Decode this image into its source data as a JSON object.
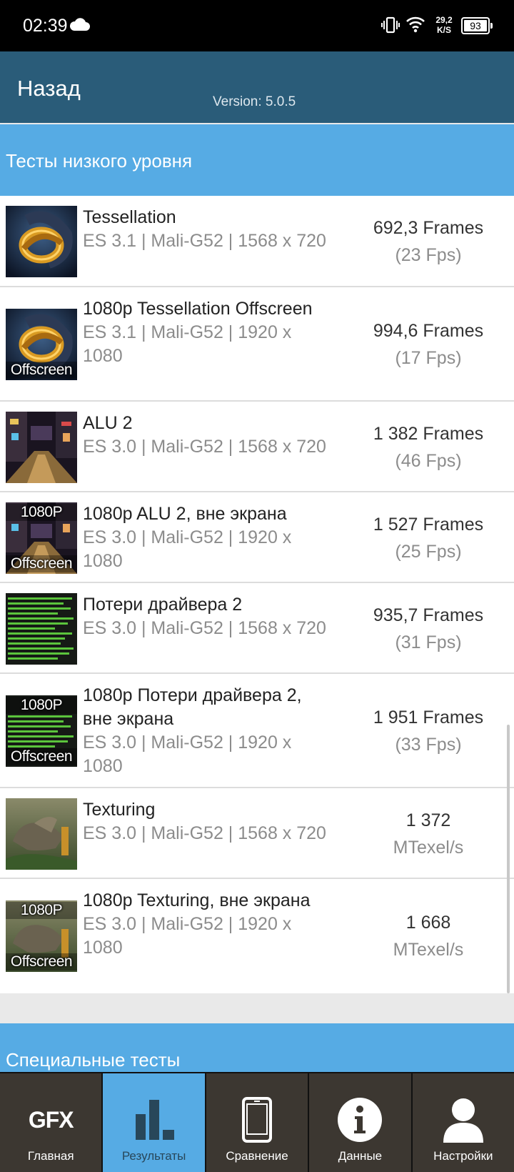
{
  "status_bar": {
    "time": "02:39",
    "net_speed_value": "29,2",
    "net_speed_unit": "K/S",
    "battery": "93"
  },
  "header": {
    "back_label": "Назад",
    "version": "Version: 5.0.5"
  },
  "section": {
    "title": "Тесты низкого уровня"
  },
  "tests": [
    {
      "name": "Tessellation",
      "spec": "ES 3.1 | Mali-G52 | 1568 x 720",
      "result": "692,3 Frames",
      "sub": "(23 Fps)",
      "thumb": "tessellation"
    },
    {
      "name": "1080p Tessellation Offscreen",
      "spec": "ES 3.1 | Mali-G52 | 1920 x 1080",
      "result": "994,6 Frames",
      "sub": "(17 Fps)",
      "thumb": "tessellation",
      "thumb_bottom": "Offscreen"
    },
    {
      "name": "ALU 2",
      "spec": "ES 3.0 | Mali-G52 | 1568 x 720",
      "result": "1 382 Frames",
      "sub": "(46 Fps)",
      "thumb": "alu"
    },
    {
      "name": "1080p ALU 2, вне экрана",
      "spec": "ES 3.0 | Mali-G52 | 1920 x 1080",
      "result": "1 527 Frames",
      "sub": "(25 Fps)",
      "thumb": "alu",
      "thumb_top": "1080P",
      "thumb_bottom": "Offscreen"
    },
    {
      "name": "Потери драйвера 2",
      "spec": "ES 3.0 | Mali-G52 | 1568 x 720",
      "result": "935,7 Frames",
      "sub": "(31 Fps)",
      "thumb": "driver"
    },
    {
      "name": "1080p Потери драйвера 2, вне экрана",
      "spec": "ES 3.0 | Mali-G52 | 1920 x 1080",
      "result": "1 951 Frames",
      "sub": "(33 Fps)",
      "thumb": "driver",
      "thumb_top": "1080P",
      "thumb_bottom": "Offscreen"
    },
    {
      "name": "Texturing",
      "spec": "ES 3.0 | Mali-G52 | 1568 x 720",
      "result": "1 372",
      "sub": "MTexel/s",
      "thumb": "texturing"
    },
    {
      "name": "1080p Texturing, вне экрана",
      "spec": "ES 3.0 | Mali-G52 | 1920 x 1080",
      "result": "1 668",
      "sub": "MTexel/s",
      "thumb": "texturing",
      "thumb_top": "1080P",
      "thumb_bottom": "Offscreen"
    }
  ],
  "special_section": {
    "title": "Специальные тесты"
  },
  "nav": {
    "items": [
      {
        "label": "Главная",
        "icon": "gfx-logo-icon",
        "icon_text": "GFX"
      },
      {
        "label": "Результаты",
        "icon": "bar-chart-icon",
        "active": true
      },
      {
        "label": "Сравнение",
        "icon": "phone-icon"
      },
      {
        "label": "Данные",
        "icon": "info-icon"
      },
      {
        "label": "Настройки",
        "icon": "user-icon"
      }
    ]
  },
  "colors": {
    "header": "#2a5c79",
    "section": "#56abe4",
    "nav": "#3c3731",
    "nav_active": "#56abe4"
  }
}
